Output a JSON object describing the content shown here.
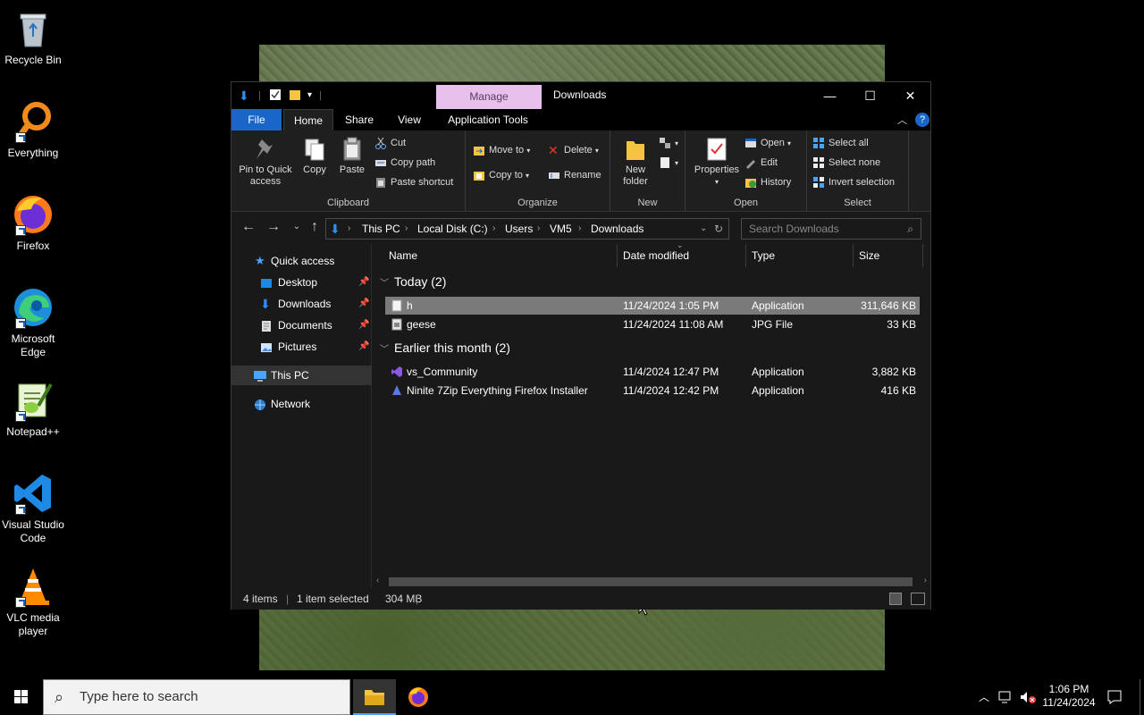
{
  "desktop": {
    "icons": [
      {
        "label": "Recycle Bin",
        "icon": "recycle-bin-icon"
      },
      {
        "label": "Everything",
        "icon": "everything-icon"
      },
      {
        "label": "Firefox",
        "icon": "firefox-icon"
      },
      {
        "label": "Microsoft Edge",
        "icon": "edge-icon"
      },
      {
        "label": "Notepad++",
        "icon": "notepadpp-icon"
      },
      {
        "label": "Visual Studio Code",
        "icon": "vscode-icon"
      },
      {
        "label": "VLC media player",
        "icon": "vlc-icon"
      }
    ]
  },
  "window": {
    "context_tab": "Manage",
    "title": "Downloads",
    "controls": {
      "minimize": "—",
      "maximize": "☐",
      "close": "✕"
    }
  },
  "ribbon_tabs": [
    "File",
    "Home",
    "Share",
    "View",
    "Application Tools"
  ],
  "ribbon": {
    "clipboard": {
      "label": "Clipboard",
      "pin": "Pin to Quick access",
      "copy": "Copy",
      "paste": "Paste",
      "cut": "Cut",
      "copy_path": "Copy path",
      "paste_shortcut": "Paste shortcut"
    },
    "organize": {
      "label": "Organize",
      "move_to": "Move to",
      "copy_to": "Copy to",
      "delete": "Delete",
      "rename": "Rename"
    },
    "new": {
      "label": "New",
      "new_folder": "New folder"
    },
    "open": {
      "label": "Open",
      "properties": "Properties",
      "open": "Open",
      "edit": "Edit",
      "history": "History"
    },
    "select": {
      "label": "Select",
      "select_all": "Select all",
      "select_none": "Select none",
      "invert": "Invert selection"
    }
  },
  "address": {
    "path": [
      "This PC",
      "Local Disk (C:)",
      "Users",
      "VM5",
      "Downloads"
    ],
    "search_placeholder": "Search Downloads"
  },
  "nav": {
    "quick_access": "Quick access",
    "items": [
      "Desktop",
      "Downloads",
      "Documents",
      "Pictures"
    ],
    "this_pc": "This PC",
    "network": "Network"
  },
  "columns": [
    "Name",
    "Date modified",
    "Type",
    "Size"
  ],
  "groups": [
    {
      "title": "Today (2)",
      "rows": [
        {
          "name": "h",
          "date": "11/24/2024 1:05 PM",
          "type": "Application",
          "size": "311,646 KB",
          "selected": true
        },
        {
          "name": "geese",
          "date": "11/24/2024 11:08 AM",
          "type": "JPG File",
          "size": "33 KB",
          "selected": false
        }
      ]
    },
    {
      "title": "Earlier this month (2)",
      "rows": [
        {
          "name": "vs_Community",
          "date": "11/4/2024 12:47 PM",
          "type": "Application",
          "size": "3,882 KB",
          "selected": false
        },
        {
          "name": "Ninite 7Zip Everything Firefox Installer",
          "date": "11/4/2024 12:42 PM",
          "type": "Application",
          "size": "416 KB",
          "selected": false
        }
      ]
    }
  ],
  "status": {
    "items": "4 items",
    "selected": "1 item selected",
    "size": "304 MB"
  },
  "taskbar": {
    "search_placeholder": "Type here to search",
    "time": "1:06 PM",
    "date": "11/24/2024"
  },
  "colors": {
    "accent": "#1a66c8",
    "manage": "#e8c0ec",
    "selection": "#7a7a7a"
  }
}
